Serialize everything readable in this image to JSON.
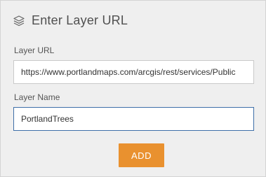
{
  "dialog": {
    "title": "Enter Layer URL",
    "icon": "layers-icon"
  },
  "layer_url": {
    "label": "Layer URL",
    "value": "https://www.portlandmaps.com/arcgis/rest/services/Public"
  },
  "layer_name": {
    "label": "Layer Name",
    "value": "PortlandTrees"
  },
  "actions": {
    "add_label": "ADD",
    "add_color": "#e9912f"
  }
}
